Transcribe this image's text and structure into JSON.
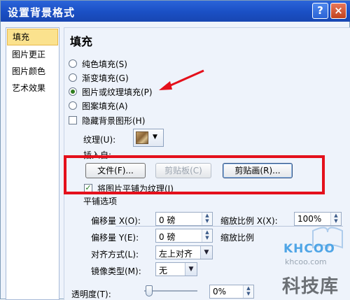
{
  "window": {
    "title": "设置背景格式",
    "help_label": "?",
    "close_label": "×"
  },
  "sidebar": {
    "items": [
      {
        "label": "填充"
      },
      {
        "label": "图片更正"
      },
      {
        "label": "图片颜色"
      },
      {
        "label": "艺术效果"
      }
    ]
  },
  "main": {
    "heading": "填充",
    "options": [
      {
        "label": "纯色填充(S)",
        "checked": false
      },
      {
        "label": "渐变填充(G)",
        "checked": false
      },
      {
        "label": "图片或纹理填充(P)",
        "checked": true
      },
      {
        "label": "图案填充(A)",
        "checked": false
      }
    ],
    "hide_background": {
      "label": "隐藏背景图形(H)",
      "checked": false
    },
    "texture_label": "纹理(U):",
    "insert_from_label": "插入自:",
    "file_button": "文件(F)...",
    "clipboard_button": "剪贴板(C)",
    "clipart_button": "剪贴画(R)...",
    "tile_checkbox": {
      "label": "将图片平铺为纹理(I)",
      "checked": true
    },
    "tiling_options_label": "平铺选项",
    "offset_x": {
      "label": "偏移量 X(O):",
      "value": "0 磅"
    },
    "offset_y": {
      "label": "偏移量 Y(E):",
      "value": "0 磅"
    },
    "scale_x": {
      "label": "缩放比例 X(X):",
      "value": "100%"
    },
    "scale_y": {
      "label": "缩放比例"
    },
    "alignment": {
      "label": "对齐方式(L):",
      "value": "左上对齐"
    },
    "mirror": {
      "label": "镜像类型(M):",
      "value": "无"
    },
    "transparency": {
      "label": "透明度(T):",
      "value": "0%"
    }
  },
  "watermark": {
    "brand": "KHCOO",
    "site": "khcoo.com",
    "name": "科技库"
  }
}
